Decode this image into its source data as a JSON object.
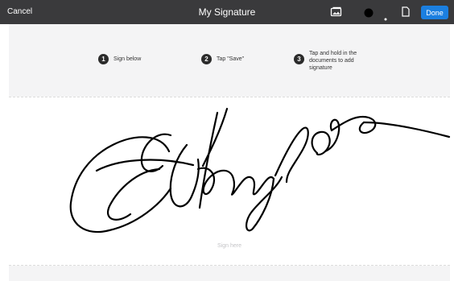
{
  "toolbar": {
    "cancel_label": "Cancel",
    "title": "My Signature",
    "done_label": "Done",
    "icons": [
      "image-icon",
      "color-swatch-icon",
      "pen-size-icon",
      "page-icon"
    ],
    "accent_color": "#1b7fe0",
    "bar_color": "#3a3a3c"
  },
  "steps": [
    {
      "number": "1",
      "text": "Sign below"
    },
    {
      "number": "2",
      "text": "Tap \"Save\""
    },
    {
      "number": "3",
      "text": "Tap and hold in the documents to add signature"
    }
  ],
  "canvas": {
    "hint": "Sign here"
  }
}
